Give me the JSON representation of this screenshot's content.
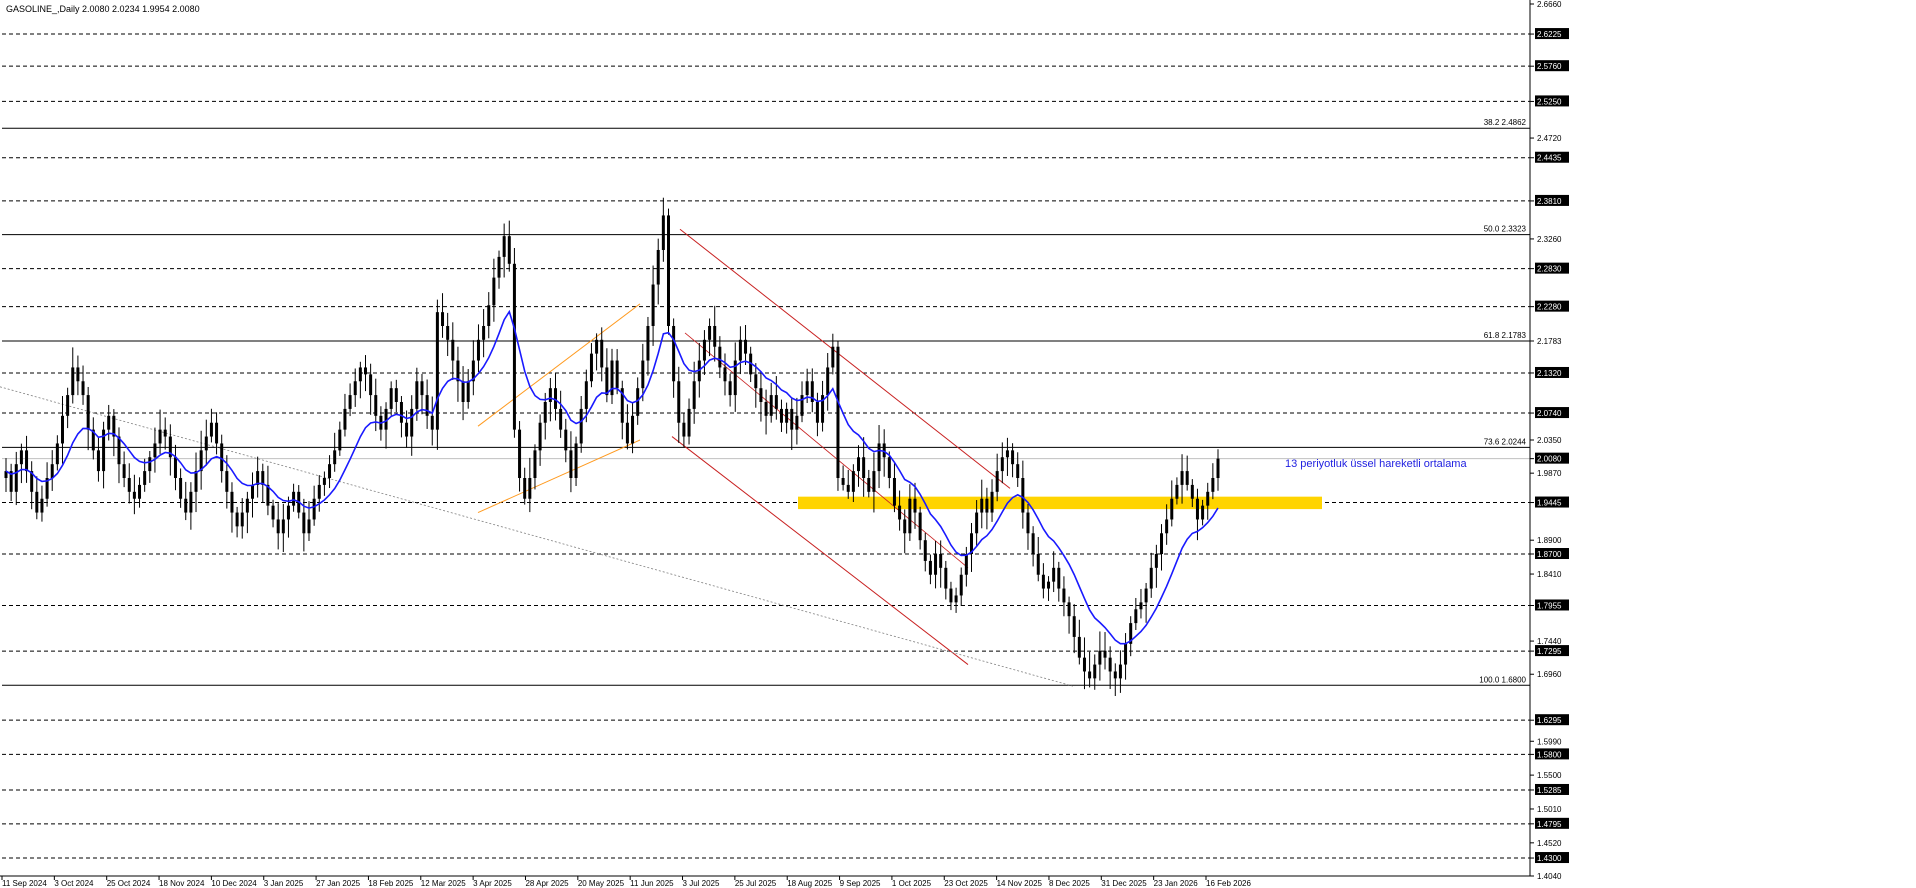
{
  "header": "GASOLINE_,Daily  2.0080 2.0234 1.9954 2.0080",
  "chart_data": {
    "type": "candlestick",
    "symbol": "GASOLINE_",
    "timeframe": "Daily",
    "ohlc": {
      "open": 2.008,
      "high": 2.0234,
      "low": 1.9954,
      "close": 2.008
    },
    "ylim": [
      1.404,
      2.666
    ],
    "y_ticks": [
      2.666,
      2.6225,
      2.576,
      2.525,
      2.472,
      2.4435,
      2.381,
      2.326,
      2.283,
      2.228,
      2.1783,
      2.132,
      2.074,
      2.035,
      2.008,
      1.987,
      1.9445,
      1.89,
      1.87,
      1.841,
      1.7955,
      1.744,
      1.7295,
      1.696,
      1.6295,
      1.599,
      1.58,
      1.55,
      1.5285,
      1.501,
      1.4795,
      1.452,
      1.43,
      1.404
    ],
    "y_tick_labels": [
      "2.6660",
      "2.6225",
      "2.5760",
      "2.5250",
      "2.4720",
      "2.4435",
      "2.3810",
      "2.3260",
      "2.2830",
      "2.2280",
      "2.1783",
      "2.1320",
      "2.0740",
      "2.0350",
      "2.0080",
      "1.9870",
      "1.9445",
      "1.8900",
      "1.8700",
      "1.8410",
      "1.7955",
      "1.7440",
      "1.7295",
      "1.6960",
      "1.6295",
      "1.5990",
      "1.5800",
      "1.5500",
      "1.5285",
      "1.5010",
      "1.4795",
      "1.4520",
      "1.4300",
      "1.4040"
    ],
    "dashed_levels": [
      {
        "price": 2.6225,
        "label": "2.6225"
      },
      {
        "price": 2.576,
        "label": "2.5760"
      },
      {
        "price": 2.525,
        "label": "2.5250"
      },
      {
        "price": 2.4435,
        "label": "2.4435"
      },
      {
        "price": 2.381,
        "label": "2.3810"
      },
      {
        "price": 2.283,
        "label": "2.2830"
      },
      {
        "price": 2.228,
        "label": "2.2280"
      },
      {
        "price": 2.132,
        "label": "2.1320"
      },
      {
        "price": 2.074,
        "label": "2.0740"
      },
      {
        "price": 1.9445,
        "label": "1.9445"
      },
      {
        "price": 1.87,
        "label": "1.8700"
      },
      {
        "price": 1.7955,
        "label": "1.7955"
      },
      {
        "price": 1.7295,
        "label": "1.7295"
      },
      {
        "price": 1.6295,
        "label": "1.6295"
      },
      {
        "price": 1.58,
        "label": "1.5800"
      },
      {
        "price": 1.5285,
        "label": "1.5285"
      },
      {
        "price": 1.4795,
        "label": "1.4795"
      },
      {
        "price": 1.43,
        "label": "1.4300"
      }
    ],
    "current_price": {
      "price": 2.008,
      "label": "2.0080"
    },
    "fibonacci": [
      {
        "label": "38.2 2.4862",
        "price": 2.4862
      },
      {
        "label": "50.0 2.3323",
        "price": 2.3323
      },
      {
        "label": "61.8 2.1783",
        "price": 2.1783
      },
      {
        "label": "73.6 2.0244",
        "price": 2.0244
      },
      {
        "label": "100.0 1.6800",
        "price": 1.68
      }
    ],
    "x_labels": [
      "11 Sep 2024",
      "3 Oct 2024",
      "25 Oct 2024",
      "18 Nov 2024",
      "10 Dec 2024",
      "3 Jan 2025",
      "27 Jan 2025",
      "18 Feb 2025",
      "12 Mar 2025",
      "3 Apr 2025",
      "28 Apr 2025",
      "20 May 2025",
      "11 Jun 2025",
      "3 Jul 2025",
      "25 Jul 2025",
      "18 Aug 2025",
      "9 Sep 2025",
      "1 Oct 2025",
      "23 Oct 2025",
      "14 Nov 2025",
      "8 Dec 2025",
      "31 Dec 2025",
      "23 Jan 2026",
      "16 Feb 2026"
    ],
    "ema_label": "13 periyotluk üssel hareketli ortalama",
    "ema_period": 13,
    "support_zone": [
      1.935,
      1.953
    ],
    "colors": {
      "candle": "#000000",
      "ema": "#1a1aff",
      "zone": "#ffd400",
      "orange_channel": "#ff9a1f",
      "red_channel": "#c82020",
      "annotation": "#1f1fe0"
    },
    "closes": [
      1.99,
      1.96,
      2.0,
      2.02,
      1.99,
      1.96,
      1.93,
      1.95,
      1.98,
      2.0,
      2.03,
      2.07,
      2.1,
      2.14,
      2.12,
      2.1,
      2.05,
      2.02,
      1.99,
      2.05,
      2.07,
      2.04,
      2.0,
      1.98,
      1.96,
      1.95,
      1.97,
      1.99,
      2.01,
      2.03,
      2.05,
      2.04,
      2.01,
      1.98,
      1.95,
      1.93,
      1.96,
      1.99,
      2.02,
      2.04,
      2.06,
      2.03,
      1.99,
      1.96,
      1.93,
      1.91,
      1.93,
      1.95,
      1.97,
      1.99,
      1.97,
      1.94,
      1.92,
      1.9,
      1.92,
      1.94,
      1.96,
      1.93,
      1.9,
      1.92,
      1.95,
      1.97,
      1.98,
      2.0,
      2.02,
      2.05,
      2.08,
      2.1,
      2.12,
      2.14,
      2.13,
      2.1,
      2.07,
      2.05,
      2.08,
      2.11,
      2.09,
      2.06,
      2.04,
      2.08,
      2.12,
      2.1,
      2.07,
      2.05,
      2.22,
      2.2,
      2.18,
      2.15,
      2.12,
      2.09,
      2.12,
      2.15,
      2.18,
      2.2,
      2.23,
      2.27,
      2.3,
      2.33,
      2.29,
      2.05,
      1.98,
      1.95,
      1.98,
      2.02,
      2.06,
      2.09,
      2.11,
      2.08,
      2.05,
      2.02,
      1.98,
      2.03,
      2.08,
      2.12,
      2.16,
      2.18,
      2.14,
      2.1,
      2.15,
      2.11,
      2.06,
      2.03,
      2.07,
      2.11,
      2.15,
      2.2,
      2.26,
      2.31,
      2.36,
      2.2,
      2.12,
      2.06,
      2.04,
      2.08,
      2.12,
      2.15,
      2.18,
      2.2,
      2.17,
      2.14,
      2.12,
      2.1,
      2.15,
      2.18,
      2.16,
      2.13,
      2.11,
      2.09,
      2.07,
      2.1,
      2.08,
      2.06,
      2.08,
      2.05,
      2.07,
      2.1,
      2.12,
      2.09,
      2.06,
      2.1,
      2.14,
      2.17,
      1.98,
      1.97,
      1.96,
      1.99,
      2.01,
      1.98,
      1.96,
      1.99,
      2.03,
      2.01,
      1.98,
      1.94,
      1.92,
      1.9,
      1.95,
      1.93,
      1.89,
      1.86,
      1.84,
      1.87,
      1.85,
      1.82,
      1.8,
      1.81,
      1.84,
      1.87,
      1.9,
      1.93,
      1.95,
      1.93,
      1.96,
      1.99,
      2.01,
      2.02,
      2.0,
      1.98,
      1.93,
      1.9,
      1.87,
      1.84,
      1.82,
      1.83,
      1.85,
      1.82,
      1.8,
      1.78,
      1.75,
      1.72,
      1.7,
      1.69,
      1.71,
      1.73,
      1.72,
      1.7,
      1.69,
      1.71,
      1.74,
      1.77,
      1.79,
      1.8,
      1.82,
      1.85,
      1.87,
      1.9,
      1.92,
      1.95,
      1.97,
      1.99,
      1.97,
      1.95,
      1.92,
      1.94,
      1.96,
      1.98,
      2.008
    ]
  }
}
